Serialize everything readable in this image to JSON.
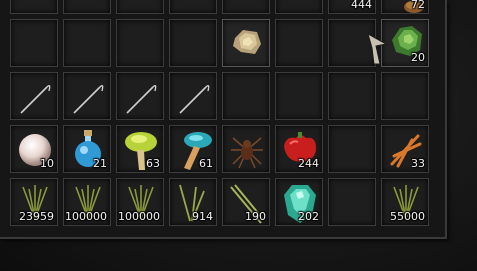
{
  "inventory": {
    "row0": {
      "slot_a_qty": "444",
      "slot_b_qty": "72"
    },
    "row1": {
      "ore_qty": "",
      "leaf_pile_qty": "20"
    },
    "row3": {
      "pearl_qty": "10",
      "potion_qty": "21",
      "green_mushroom_qty": "63",
      "blue_mushroom_qty": "61",
      "spider_qty": "",
      "red_pepper_qty": "244",
      "wood_sticks_qty": "33"
    },
    "row4": {
      "herb_a_qty": "23959",
      "herb_b_qty": "100000",
      "herb_c_qty": "100000",
      "herb_d_qty": "914",
      "herb_e_qty": "190",
      "gem_qty": "202",
      "herb_f_qty": "55000"
    }
  },
  "colors": {
    "slot_bg": "#1e1e1e",
    "slot_border": "#3c3c3c",
    "panel_border": "#3a3a3a",
    "text": "#f2f2f2"
  }
}
